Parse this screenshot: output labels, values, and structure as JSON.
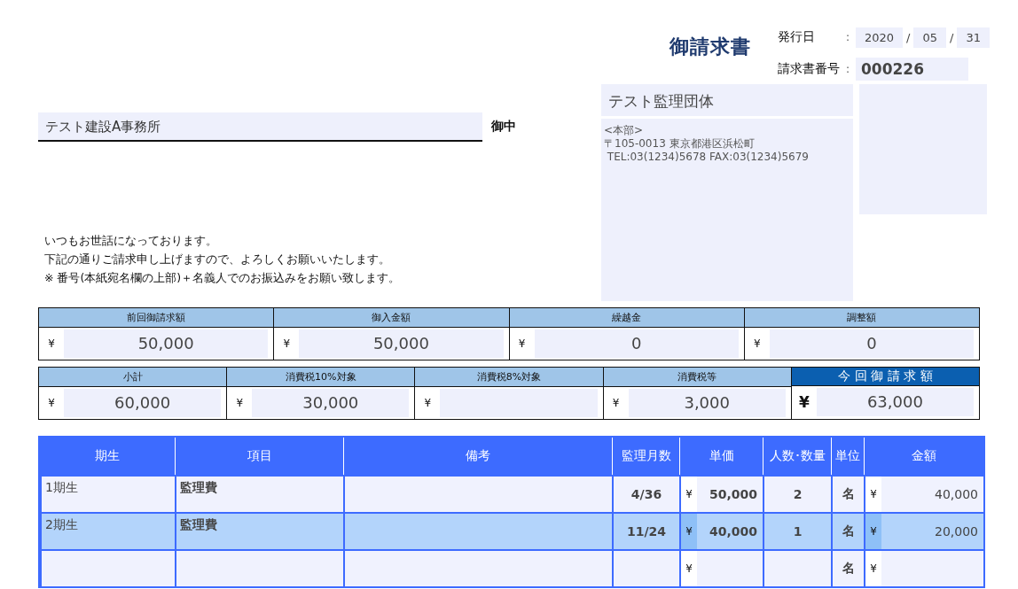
{
  "header": {
    "title": "御請求書",
    "issue_date_label": "発行日",
    "issue_year": "2020",
    "issue_month": "05",
    "issue_day": "31",
    "date_separator": "/",
    "invoice_no_label": "請求書番号",
    "invoice_no": "000226",
    "colon": ":"
  },
  "addressee": {
    "name": "テスト建設A事務所",
    "honorific": "御中"
  },
  "issuer": {
    "name": "テスト監理団体",
    "lines": [
      "<本部>",
      "〒105-0013 東京都港区浜松町",
      " TEL:03(1234)5678 FAX:03(1234)5679"
    ]
  },
  "greeting": [
    "いつもお世話になっております。",
    "下記の通りご請求申し上げますので、よろしくお願いいたします。",
    "※ 番号(本紙宛名欄の上部)＋名義人でのお振込みをお願い致します。"
  ],
  "summary_rows": [
    [
      {
        "label": "前回御請求額",
        "currency": "¥",
        "value": "50,000",
        "kind": "normal"
      },
      {
        "label": "御入金額",
        "currency": "¥",
        "value": "50,000",
        "kind": "normal"
      },
      {
        "label": "繰越金",
        "currency": "¥",
        "value": "0",
        "kind": "normal"
      },
      {
        "label": "調整額",
        "currency": "¥",
        "value": "0",
        "kind": "normal"
      }
    ],
    [
      {
        "label": "小計",
        "currency": "¥",
        "value": "60,000",
        "kind": "normal"
      },
      {
        "label": "消費税10%対象",
        "currency": "¥",
        "value": "30,000",
        "kind": "normal"
      },
      {
        "label": "消費税8%対象",
        "currency": "¥",
        "kind": "normal"
      },
      {
        "label": "消費税等",
        "currency": "¥",
        "value": "3,000",
        "kind": "normal"
      },
      {
        "label": "今 回 御 請 求 額",
        "currency": "¥",
        "value": "63,000",
        "kind": "total"
      }
    ]
  ],
  "table": {
    "columns": [
      "期生",
      "項目",
      "備考",
      "監理月数",
      "単価",
      "人数･数量",
      "単位",
      "金額"
    ],
    "rows": [
      {
        "term": "1期生",
        "item": "監理費",
        "months": "4/36",
        "price_currency": "¥",
        "unit_price": "50,000",
        "quantity": "2",
        "unit": "名",
        "amount_currency": "¥",
        "amount": "40,000",
        "selected": false
      },
      {
        "term": "2期生",
        "item": "監理費",
        "months": "11/24",
        "price_currency": "¥",
        "unit_price": "40,000",
        "quantity": "1",
        "unit": "名",
        "amount_currency": "¥",
        "amount": "20,000",
        "selected": true
      },
      {
        "price_currency": "¥",
        "unit": "名",
        "amount_currency": "¥",
        "selected": false
      }
    ]
  }
}
